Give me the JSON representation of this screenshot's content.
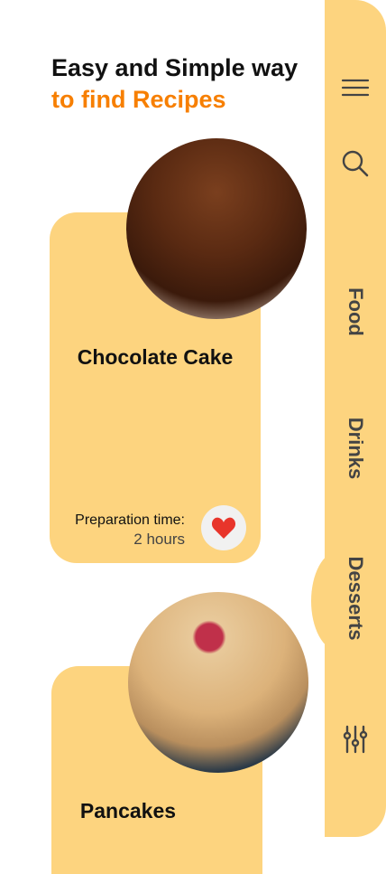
{
  "header": {
    "line1": "Easy and Simple way",
    "line2": "to find Recipes"
  },
  "sidebar": {
    "tabs": [
      {
        "label": "Food"
      },
      {
        "label": "Drinks"
      },
      {
        "label": "Desserts",
        "selected": true
      }
    ],
    "icons": [
      "menu-icon",
      "search-icon",
      "filter-icon"
    ]
  },
  "recipes": [
    {
      "name": "Chocolate Cake",
      "prep_label": "Preparation time:",
      "prep_value": "2 hours",
      "favorite": true
    },
    {
      "name": "Pancakes"
    }
  ],
  "colors": {
    "panel": "#FDD47F",
    "accent": "#F77F00",
    "heart": "#E8352B"
  }
}
